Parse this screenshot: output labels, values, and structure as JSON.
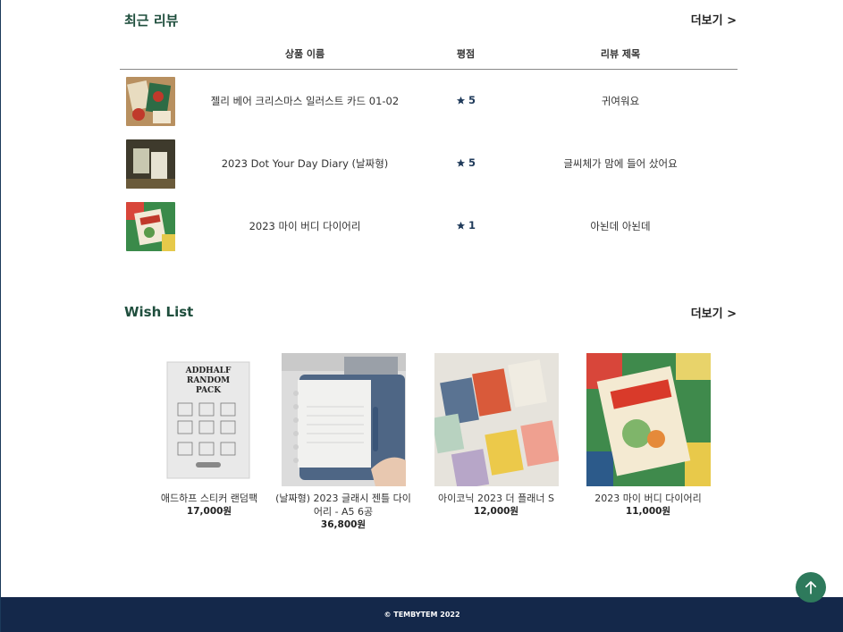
{
  "recent_reviews": {
    "title": "최근 리뷰",
    "more_label": "더보기 >",
    "columns": {
      "name": "상품 이름",
      "rating": "평점",
      "review_title": "리뷰 제목"
    },
    "rows": [
      {
        "name": "젤리 베어 크리스마스 일러스트 카드 01-02",
        "rating": "5",
        "review_title": "귀여워요"
      },
      {
        "name": "2023 Dot Your Day Diary (날짜형)",
        "rating": "5",
        "review_title": "글씨체가 맘에 들어 샀어요"
      },
      {
        "name": "2023 마이 버디 다이어리",
        "rating": "1",
        "review_title": "아뇐데 아뇐데"
      }
    ]
  },
  "wish_list": {
    "title": "Wish List",
    "more_label": "더보기 >",
    "items": [
      {
        "name": "애드하프 스티커 랜덤팩",
        "price": "17,000원",
        "image_text": [
          "ADDHALF",
          "RANDOM",
          "PACK"
        ]
      },
      {
        "name": "(날짜형) 2023 글래시 젠틀 다이어리 - A5 6공",
        "price": "36,800원"
      },
      {
        "name": "아이코닉 2023 더 플래너 S",
        "price": "12,000원"
      },
      {
        "name": "2023 마이 버디 다이어리",
        "price": "11,000원"
      }
    ]
  },
  "footer": {
    "copyright": "© TEMBYTEM 2022"
  },
  "icons": {
    "star": "star-icon",
    "top": "arrow-up-icon"
  },
  "colors": {
    "accent": "#1f4e3d",
    "footer_bg": "#14284a",
    "top_button": "#2e7a5c",
    "star": "#1f3a5a"
  }
}
